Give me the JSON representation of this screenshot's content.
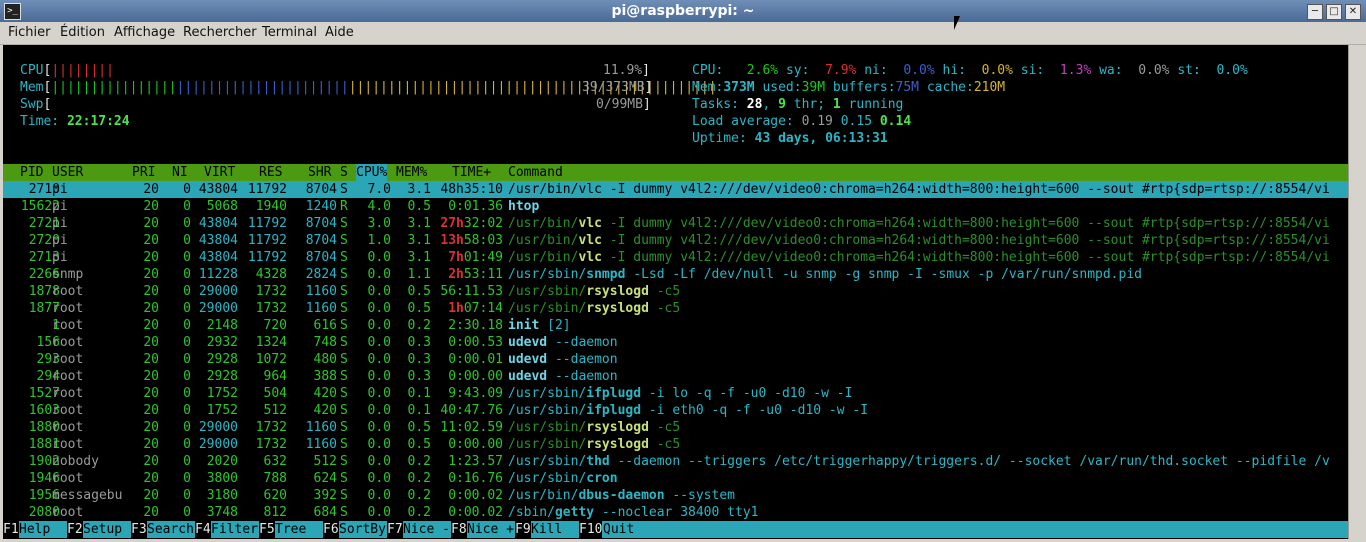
{
  "window": {
    "title": "pi@raspberrypi: ~"
  },
  "menu": [
    "Fichier",
    "Édition",
    "Affichage",
    "Rechercher",
    "Terminal",
    "Aide"
  ],
  "meters": {
    "cpu_label": "CPU",
    "cpu_bar": "||||||||",
    "cpu_value": "11.9%",
    "mem_label": "Mem",
    "mem_bar_green": "||||||||||||||||",
    "mem_bar_blue": "||||||||||||||||||||||",
    "mem_bar_yellow": "|||||||||||||||||||||||||||||||||||||||||||||||",
    "mem_value": "39/373MB",
    "swp_label": "Swp",
    "swp_value": "0/99MB",
    "time_label": "Time:",
    "time_value": "22:17:24"
  },
  "cpu_detail": {
    "label": "CPU:",
    "us": "2.6%",
    "sy_label": "sy:",
    "sy": "7.9%",
    "ni_label": "ni:",
    "ni": "0.0%",
    "hi_label": "hi:",
    "hi": "0.0%",
    "si_label": "si:",
    "si": "1.3%",
    "wa_label": "wa:",
    "wa": "0.0%",
    "st_label": "st:",
    "st": "0.0%"
  },
  "mem_detail": {
    "label": "Mem:",
    "total": "373M",
    "used_label": "used:",
    "used": "39M",
    "buffers_label": "buffers:",
    "buffers": "75M",
    "cache_label": "cache:",
    "cache": "210M"
  },
  "tasks": {
    "label": "Tasks:",
    "count": "28",
    "thr_count": "9",
    "thr_label": "thr;",
    "running_count": "1",
    "running_label": "running"
  },
  "load": {
    "label": "Load average:",
    "l1": "0.19",
    "l5": "0.15",
    "l15": "0.14"
  },
  "uptime": {
    "label": "Uptime:",
    "value": "43 days, 06:13:31"
  },
  "columns": [
    "PID",
    "USER",
    "PRI",
    "NI",
    "VIRT",
    "RES",
    "SHR",
    "S",
    "CPU%",
    "MEM%",
    "TIME+",
    "Command"
  ],
  "processes": [
    {
      "pid": "2710",
      "user": "pi",
      "pri": "20",
      "ni": "0",
      "virt": "43804",
      "res": "11792",
      "shr": "8704",
      "s": "S",
      "cpu": "7.0",
      "mem": "3.1",
      "time_hi": "",
      "time": "48h35:10",
      "cmd_path": "/usr/bin/",
      "cmd_name": "vlc",
      "cmd_args": " -I dummy v4l2:///dev/video0:chroma=h264:width=800:height=600 --sout #rtp{sdp=rtsp://:8554/vi"
    },
    {
      "pid": "15622",
      "user": "pi",
      "pri": "20",
      "ni": "0",
      "virt": "5068",
      "res": "1940",
      "shr": "1240",
      "s": "R",
      "cpu": "4.0",
      "mem": "0.5",
      "time_hi": "",
      "time": "0:01.36",
      "cmd_path": "",
      "cmd_name": "htop",
      "cmd_args": ""
    },
    {
      "pid": "2721",
      "user": "pi",
      "pri": "20",
      "ni": "0",
      "virt": "43804",
      "res": "11792",
      "shr": "8704",
      "s": "S",
      "cpu": "3.0",
      "mem": "3.1",
      "time_hi": "27h",
      "time": "32:02",
      "cmd_path": "/usr/bin/",
      "cmd_name": "vlc",
      "cmd_args": " -I dummy v4l2:///dev/video0:chroma=h264:width=800:height=600 --sout #rtp{sdp=rtsp://:8554/vi"
    },
    {
      "pid": "2720",
      "user": "pi",
      "pri": "20",
      "ni": "0",
      "virt": "43804",
      "res": "11792",
      "shr": "8704",
      "s": "S",
      "cpu": "1.0",
      "mem": "3.1",
      "time_hi": "13h",
      "time": "58:03",
      "cmd_path": "/usr/bin/",
      "cmd_name": "vlc",
      "cmd_args": " -I dummy v4l2:///dev/video0:chroma=h264:width=800:height=600 --sout #rtp{sdp=rtsp://:8554/vi"
    },
    {
      "pid": "2713",
      "user": "pi",
      "pri": "20",
      "ni": "0",
      "virt": "43804",
      "res": "11792",
      "shr": "8704",
      "s": "S",
      "cpu": "0.0",
      "mem": "3.1",
      "time_hi": "7h",
      "time": "01:49",
      "cmd_path": "/usr/bin/",
      "cmd_name": "vlc",
      "cmd_args": " -I dummy v4l2:///dev/video0:chroma=h264:width=800:height=600 --sout #rtp{sdp=rtsp://:8554/vi"
    },
    {
      "pid": "2266",
      "user": "snmp",
      "pri": "20",
      "ni": "0",
      "virt": "11228",
      "res": "4328",
      "shr": "2824",
      "s": "S",
      "cpu": "0.0",
      "mem": "1.1",
      "time_hi": "2h",
      "time": "53:11",
      "cmd_path": "/usr/sbin/",
      "cmd_name": "snmpd",
      "cmd_args": " -Lsd -Lf /dev/null -u snmp -g snmp -I -smux -p /var/run/snmpd.pid"
    },
    {
      "pid": "1878",
      "user": "root",
      "pri": "20",
      "ni": "0",
      "virt": "29000",
      "res": "1732",
      "shr": "1160",
      "s": "S",
      "cpu": "0.0",
      "mem": "0.5",
      "time_hi": "",
      "time": "56:11.53",
      "cmd_path": "/usr/sbin/",
      "cmd_name": "rsyslogd",
      "cmd_args": " -c5"
    },
    {
      "pid": "1877",
      "user": "root",
      "pri": "20",
      "ni": "0",
      "virt": "29000",
      "res": "1732",
      "shr": "1160",
      "s": "S",
      "cpu": "0.0",
      "mem": "0.5",
      "time_hi": "1h",
      "time": "07:14",
      "cmd_path": "/usr/sbin/",
      "cmd_name": "rsyslogd",
      "cmd_args": " -c5"
    },
    {
      "pid": "1",
      "user": "root",
      "pri": "20",
      "ni": "0",
      "virt": "2148",
      "res": "720",
      "shr": "616",
      "s": "S",
      "cpu": "0.0",
      "mem": "0.2",
      "time_hi": "",
      "time": "2:30.18",
      "cmd_path": "",
      "cmd_name": "init",
      "cmd_args": " [2]"
    },
    {
      "pid": "156",
      "user": "root",
      "pri": "20",
      "ni": "0",
      "virt": "2932",
      "res": "1324",
      "shr": "748",
      "s": "S",
      "cpu": "0.0",
      "mem": "0.3",
      "time_hi": "",
      "time": "0:00.53",
      "cmd_path": "",
      "cmd_name": "udevd",
      "cmd_args": " --daemon"
    },
    {
      "pid": "293",
      "user": "root",
      "pri": "20",
      "ni": "0",
      "virt": "2928",
      "res": "1072",
      "shr": "480",
      "s": "S",
      "cpu": "0.0",
      "mem": "0.3",
      "time_hi": "",
      "time": "0:00.01",
      "cmd_path": "",
      "cmd_name": "udevd",
      "cmd_args": " --daemon"
    },
    {
      "pid": "294",
      "user": "root",
      "pri": "20",
      "ni": "0",
      "virt": "2928",
      "res": "964",
      "shr": "388",
      "s": "S",
      "cpu": "0.0",
      "mem": "0.3",
      "time_hi": "",
      "time": "0:00.00",
      "cmd_path": "",
      "cmd_name": "udevd",
      "cmd_args": " --daemon"
    },
    {
      "pid": "1527",
      "user": "root",
      "pri": "20",
      "ni": "0",
      "virt": "1752",
      "res": "504",
      "shr": "420",
      "s": "S",
      "cpu": "0.0",
      "mem": "0.1",
      "time_hi": "",
      "time": "9:43.09",
      "cmd_path": "/usr/sbin/",
      "cmd_name": "ifplugd",
      "cmd_args": " -i lo -q -f -u0 -d10 -w -I"
    },
    {
      "pid": "1603",
      "user": "root",
      "pri": "20",
      "ni": "0",
      "virt": "1752",
      "res": "512",
      "shr": "420",
      "s": "S",
      "cpu": "0.0",
      "mem": "0.1",
      "time_hi": "",
      "time": "40:47.76",
      "cmd_path": "/usr/sbin/",
      "cmd_name": "ifplugd",
      "cmd_args": " -i eth0 -q -f -u0 -d10 -w -I"
    },
    {
      "pid": "1880",
      "user": "root",
      "pri": "20",
      "ni": "0",
      "virt": "29000",
      "res": "1732",
      "shr": "1160",
      "s": "S",
      "cpu": "0.0",
      "mem": "0.5",
      "time_hi": "",
      "time": "11:02.59",
      "cmd_path": "/usr/sbin/",
      "cmd_name": "rsyslogd",
      "cmd_args": " -c5"
    },
    {
      "pid": "1881",
      "user": "root",
      "pri": "20",
      "ni": "0",
      "virt": "29000",
      "res": "1732",
      "shr": "1160",
      "s": "S",
      "cpu": "0.0",
      "mem": "0.5",
      "time_hi": "",
      "time": "0:00.00",
      "cmd_path": "/usr/sbin/",
      "cmd_name": "rsyslogd",
      "cmd_args": " -c5"
    },
    {
      "pid": "1902",
      "user": "nobody",
      "pri": "20",
      "ni": "0",
      "virt": "2020",
      "res": "632",
      "shr": "512",
      "s": "S",
      "cpu": "0.0",
      "mem": "0.2",
      "time_hi": "",
      "time": "1:23.57",
      "cmd_path": "/usr/sbin/",
      "cmd_name": "thd",
      "cmd_args": " --daemon --triggers /etc/triggerhappy/triggers.d/ --socket /var/run/thd.socket --pidfile /v"
    },
    {
      "pid": "1946",
      "user": "root",
      "pri": "20",
      "ni": "0",
      "virt": "3800",
      "res": "788",
      "shr": "624",
      "s": "S",
      "cpu": "0.0",
      "mem": "0.2",
      "time_hi": "",
      "time": "0:16.76",
      "cmd_path": "/usr/sbin/",
      "cmd_name": "cron",
      "cmd_args": ""
    },
    {
      "pid": "1956",
      "user": "messagebu",
      "pri": "20",
      "ni": "0",
      "virt": "3180",
      "res": "620",
      "shr": "392",
      "s": "S",
      "cpu": "0.0",
      "mem": "0.2",
      "time_hi": "",
      "time": "0:00.02",
      "cmd_path": "/usr/bin/",
      "cmd_name": "dbus-daemon",
      "cmd_args": " --system"
    },
    {
      "pid": "2080",
      "user": "root",
      "pri": "20",
      "ni": "0",
      "virt": "3748",
      "res": "812",
      "shr": "684",
      "s": "S",
      "cpu": "0.0",
      "mem": "0.2",
      "time_hi": "",
      "time": "0:00.02",
      "cmd_path": "/sbin/",
      "cmd_name": "getty",
      "cmd_args": " --noclear 38400 tty1"
    }
  ],
  "fkeys": [
    {
      "key": "F1",
      "label": "Help  "
    },
    {
      "key": "F2",
      "label": "Setup "
    },
    {
      "key": "F3",
      "label": "Search"
    },
    {
      "key": "F4",
      "label": "Filter"
    },
    {
      "key": "F5",
      "label": "Tree  "
    },
    {
      "key": "F6",
      "label": "SortBy"
    },
    {
      "key": "F7",
      "label": "Nice -"
    },
    {
      "key": "F8",
      "label": "Nice +"
    },
    {
      "key": "F9",
      "label": "Kill  "
    },
    {
      "key": "F10",
      "label": "Quit"
    }
  ]
}
